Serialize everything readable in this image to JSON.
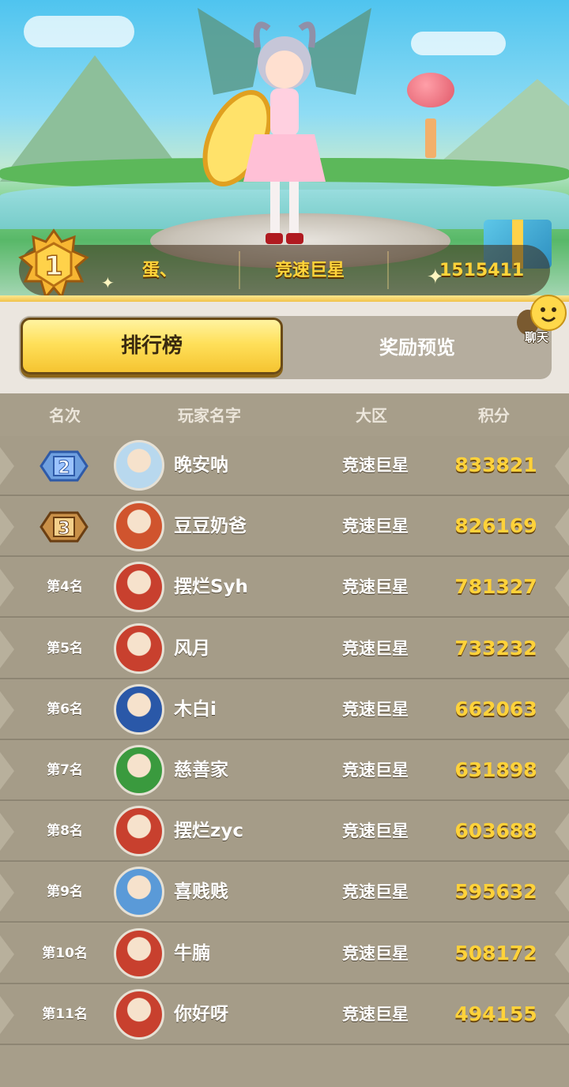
{
  "top_player": {
    "rank": "1",
    "name": "蛋、",
    "region": "竞速巨星",
    "score": "1515411"
  },
  "tabs": [
    {
      "label": "排行榜",
      "active": true
    },
    {
      "label": "奖励预览",
      "active": false
    }
  ],
  "chat": {
    "label": "聊天"
  },
  "table": {
    "headers": {
      "rank": "名次",
      "name": "玩家名字",
      "region": "大区",
      "score": "积分"
    },
    "rows": [
      {
        "rank": "2",
        "medal": "silver",
        "name": "晚安呐",
        "region": "竞速巨星",
        "score": "833821",
        "avatar_color": "#b8d8ee"
      },
      {
        "rank": "3",
        "medal": "bronze",
        "name": "豆豆奶爸",
        "region": "竞速巨星",
        "score": "826169",
        "avatar_color": "#d0542e"
      },
      {
        "rank": "第4名",
        "name": "摆烂Syh",
        "region": "竞速巨星",
        "score": "781327",
        "avatar_color": "#c8402e"
      },
      {
        "rank": "第5名",
        "name": "风月",
        "region": "竞速巨星",
        "score": "733232",
        "avatar_color": "#c8402e"
      },
      {
        "rank": "第6名",
        "name": "木白i",
        "region": "竞速巨星",
        "score": "662063",
        "avatar_color": "#2a58a8"
      },
      {
        "rank": "第7名",
        "name": "慈善家",
        "region": "竞速巨星",
        "score": "631898",
        "avatar_color": "#3a9a3e"
      },
      {
        "rank": "第8名",
        "name": "摆烂zyc",
        "region": "竞速巨星",
        "score": "603688",
        "avatar_color": "#c8402e"
      },
      {
        "rank": "第9名",
        "name": "喜贱贱",
        "region": "竞速巨星",
        "score": "595632",
        "avatar_color": "#5a9ad8"
      },
      {
        "rank": "第10名",
        "name": "牛腩",
        "region": "竞速巨星",
        "score": "508172",
        "avatar_color": "#c8402e"
      },
      {
        "rank": "第11名",
        "name": "你好呀",
        "region": "竞速巨星",
        "score": "494155",
        "avatar_color": "#c8402e"
      }
    ]
  },
  "colors": {
    "gold": "#ffd23a",
    "panel": "#a59c88",
    "tab_active": "#ffe05a"
  }
}
